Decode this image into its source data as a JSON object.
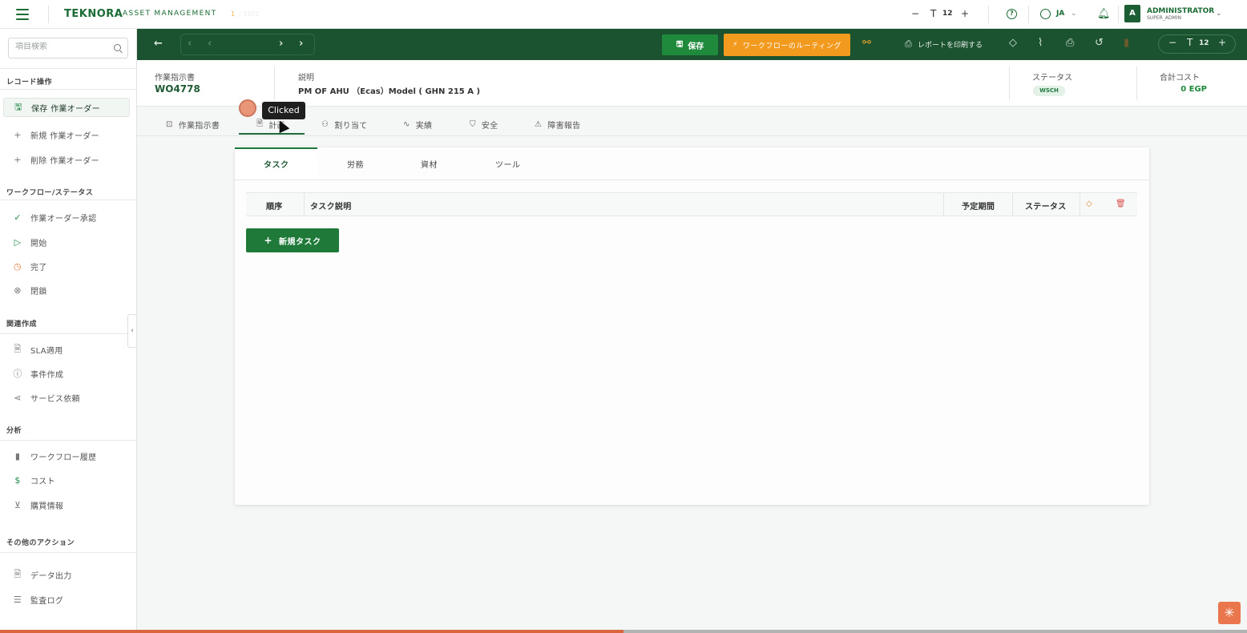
{
  "app": {
    "brand": "TEKNORA",
    "brand_sub": "ASSET MANAGEMENT",
    "font_size": "12",
    "language": "JA",
    "user_name": "ADMINISTRATOR",
    "user_role": "SUPER_ADMIN",
    "avatar_letter": "A"
  },
  "sidebar": {
    "search_placeholder": "項目検索",
    "sections": [
      {
        "title": "レコード操作"
      },
      {
        "title": "ワークフロー/ステータス"
      },
      {
        "title": "関連作成"
      },
      {
        "title": "分析"
      },
      {
        "title": "その他のアクション"
      }
    ],
    "record_ops": [
      {
        "label": "保存 作業オーダー",
        "icon": "save-icon"
      },
      {
        "label": "新規 作業オーダー",
        "icon": "plus-icon"
      },
      {
        "label": "削除 作業オーダー",
        "icon": "plus-icon"
      }
    ],
    "workflow": [
      {
        "label": "作業オーダー承認",
        "icon": "check-circle-icon"
      },
      {
        "label": "開始",
        "icon": "play-icon"
      },
      {
        "label": "完了",
        "icon": "clock-icon"
      },
      {
        "label": "閉鎖",
        "icon": "x-circle-icon"
      }
    ],
    "related": [
      {
        "label": "SLA適用",
        "icon": "document-icon"
      },
      {
        "label": "事件作成",
        "icon": "alert-circle-icon"
      },
      {
        "label": "サービス依頼",
        "icon": "share-icon"
      }
    ],
    "analysis": [
      {
        "label": "ワークフロー履歴",
        "icon": "bar-chart-icon"
      },
      {
        "label": "コスト",
        "icon": "dollar-icon"
      },
      {
        "label": "購買情報",
        "icon": "cart-icon"
      }
    ],
    "other": [
      {
        "label": "データ出力",
        "icon": "document-icon"
      },
      {
        "label": "監査ログ",
        "icon": "list-icon"
      }
    ]
  },
  "toolbar": {
    "pager_current": "1",
    "pager_total": "/ 1552",
    "save_label": "保存",
    "workflow_label": "ワークフローのルーティング",
    "print_report_label": "レポートを印刷する",
    "font_size": "12"
  },
  "record": {
    "wo_label": "作業指示書",
    "wo_value": "WO4778",
    "desc_label": "説明",
    "desc_value": "PM OF AHU （Ecas）Model ( GHN 215 A )",
    "status_label": "ステータス",
    "status_value": "WSCH",
    "cost_label": "合計コスト",
    "cost_value": "0 EGP"
  },
  "main_tabs": [
    {
      "label": "作業指示書",
      "icon": "briefcase-icon"
    },
    {
      "label": "計画",
      "icon": "document-icon"
    },
    {
      "label": "割り当て",
      "icon": "user-check-icon"
    },
    {
      "label": "実績",
      "icon": "activity-icon"
    },
    {
      "label": "安全",
      "icon": "shield-icon"
    },
    {
      "label": "障害報告",
      "icon": "warning-icon"
    }
  ],
  "sub_tabs": [
    "タスク",
    "労務",
    "資材",
    "ツール"
  ],
  "task_table": {
    "columns": [
      "順序",
      "タスク説明",
      "予定期間",
      "ステータス"
    ],
    "rows": []
  },
  "new_task_label": "新規タスク",
  "overlay": {
    "tooltip": "Clicked"
  },
  "colors": {
    "primary_green": "#1b5230",
    "accent_orange": "#f19a1e",
    "save_green": "#1f8a3b"
  }
}
